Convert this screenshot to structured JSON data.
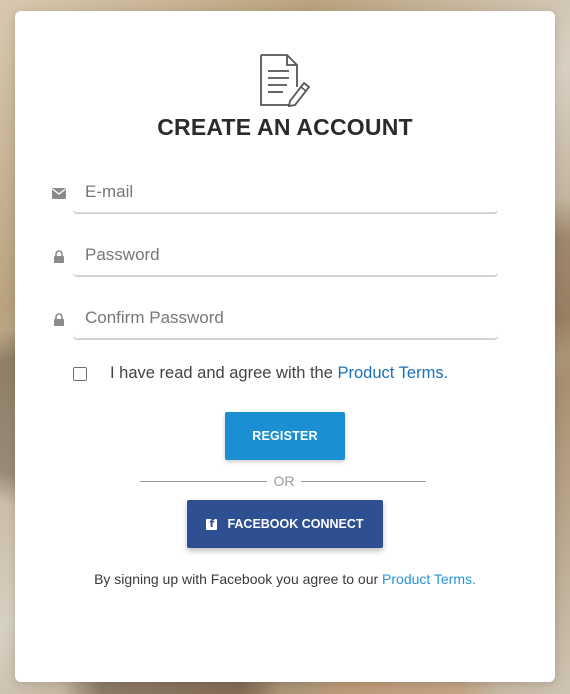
{
  "heading": "CREATE AN ACCOUNT",
  "fields": {
    "email": {
      "placeholder": "E-mail",
      "value": ""
    },
    "password": {
      "placeholder": "Password",
      "value": ""
    },
    "confirm_password": {
      "placeholder": "Confirm Password",
      "value": ""
    }
  },
  "agree": {
    "checked": false,
    "text": "I have read and agree with the ",
    "link": "Product Terms."
  },
  "register_label": "REGISTER",
  "or_label": "OR",
  "facebook_label": "FACEBOOK CONNECT",
  "facebook_note": {
    "text": "By signing up with Facebook you agree to our ",
    "link": "Product Terms."
  },
  "icons": {
    "header": "document-edit-icon",
    "email": "envelope-icon",
    "password": "lock-icon",
    "confirm": "lock-icon",
    "facebook": "facebook-icon"
  },
  "colors": {
    "register": "#1c8fd2",
    "facebook": "#2f4f93",
    "link": "#1a6fb8"
  }
}
